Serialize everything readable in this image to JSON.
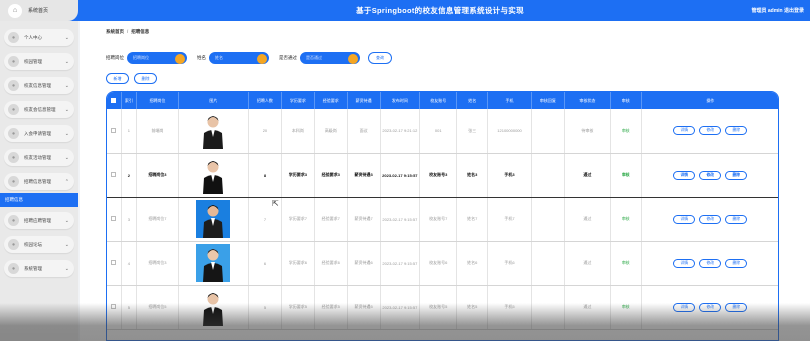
{
  "header": {
    "home_label": "系统首页",
    "title": "基于Springboot的校友信息管理系统设计与实现",
    "user_text": "管理员 admin  退出登录"
  },
  "sidebar": {
    "items": [
      {
        "label": "个人中心"
      },
      {
        "label": "校园管理"
      },
      {
        "label": "校友信息管理"
      },
      {
        "label": "校友会信息管理"
      },
      {
        "label": "入会申请管理"
      },
      {
        "label": "校友活动管理"
      },
      {
        "label": "招聘信息管理"
      },
      {
        "label": "招聘应聘管理"
      },
      {
        "label": "校园论坛"
      },
      {
        "label": "系统管理"
      }
    ],
    "active_sub": "招聘信息"
  },
  "breadcrumb": {
    "home": "系统首页",
    "current": "招聘信息"
  },
  "search": {
    "field1_label": "招聘岗位",
    "field1_placeholder": "招聘岗位",
    "field2_label": "姓名",
    "field2_placeholder": "姓名",
    "field3_label": "是否通过",
    "field3_placeholder": "是否通过",
    "search_button": "查询"
  },
  "actions": {
    "add": "新增",
    "delete": "删除"
  },
  "table": {
    "headers": [
      "索引",
      "招聘岗位",
      "图片",
      "招聘人数",
      "学历要求",
      "经验要求",
      "薪资待遇",
      "发布时间",
      "校友账号",
      "姓名",
      "手机",
      "审核回复",
      "审核状态",
      "审核",
      "操作"
    ],
    "rows": [
      {
        "idx": "1",
        "job": "前端岗",
        "count": "20",
        "edu": "本科岗",
        "exp": "高级岗",
        "pay": "面议",
        "time": "2023-02-17 9:21:12",
        "acct": "001",
        "name": "张三",
        "phone": "12100000000",
        "reply": "",
        "status": "待审核",
        "audit": "审核"
      },
      {
        "idx": "2",
        "job": "招聘岗位3",
        "count": "8",
        "edu": "学历要求3",
        "exp": "经验要求3",
        "pay": "薪资待遇3",
        "time": "2023-02-17 9:15:57",
        "acct": "校友账号3",
        "name": "姓名3",
        "phone": "手机3",
        "reply": "",
        "status": "通过",
        "audit": "审核"
      },
      {
        "idx": "3",
        "job": "招聘岗位7",
        "count": "7",
        "edu": "学历要求7",
        "exp": "经验要求7",
        "pay": "薪资待遇7",
        "time": "2023-02-17 9:15:57",
        "acct": "校友账号7",
        "name": "姓名7",
        "phone": "手机7",
        "reply": "",
        "status": "通过",
        "audit": "审核"
      },
      {
        "idx": "4",
        "job": "招聘岗位3",
        "count": "6",
        "edu": "学历要求6",
        "exp": "经验要求6",
        "pay": "薪资待遇6",
        "time": "2023-02-17 9:15:57",
        "acct": "校友账号6",
        "name": "姓名6",
        "phone": "手机6",
        "reply": "",
        "status": "通过",
        "audit": "审核"
      },
      {
        "idx": "5",
        "job": "招聘岗位5",
        "count": "5",
        "edu": "学历要求5",
        "exp": "经验要求5",
        "pay": "薪资待遇5",
        "time": "2023-02-17 9:15:57",
        "acct": "校友账号5",
        "name": "姓名5",
        "phone": "手机5",
        "reply": "",
        "status": "通过",
        "audit": "审核"
      }
    ],
    "op_labels": {
      "detail": "详情",
      "edit": "修改",
      "delete": "删除"
    }
  },
  "colors": {
    "accent": "#1d6ff3",
    "knob": "#f5a623",
    "audit_badge": "#2aa845"
  }
}
